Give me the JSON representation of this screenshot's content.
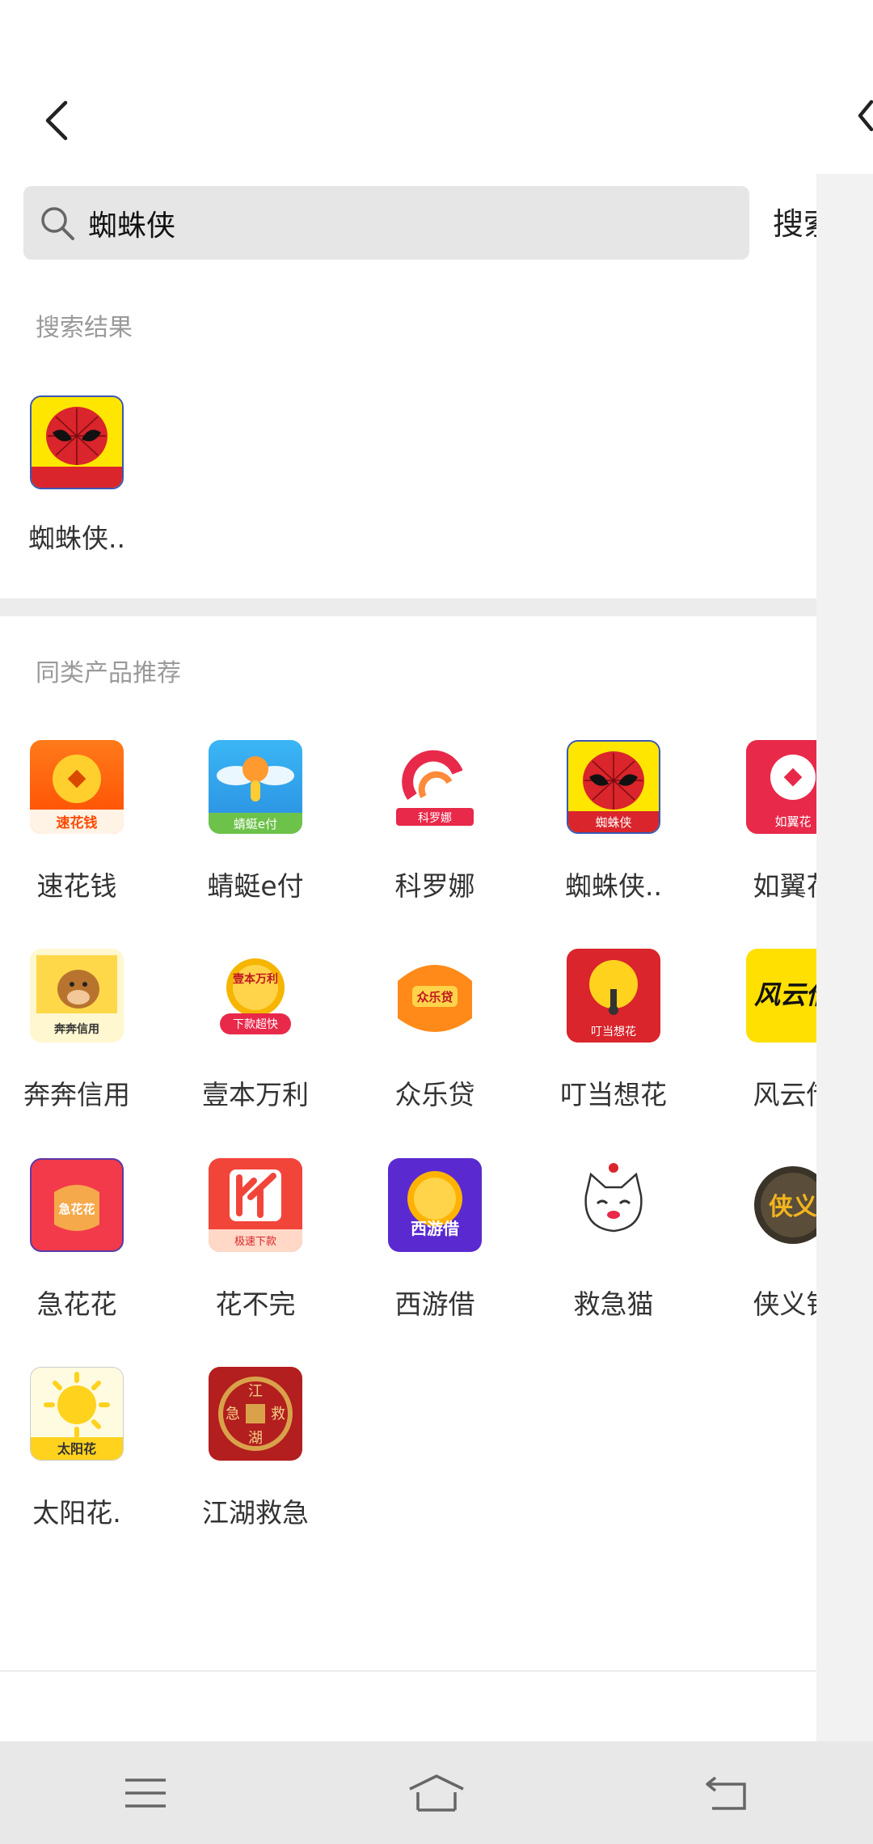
{
  "search": {
    "query": "蜘蛛侠",
    "button_label": "搜索"
  },
  "results": {
    "title": "搜索结果",
    "items": [
      {
        "label": "蜘蛛侠..",
        "icon": "spiderman-app-icon"
      }
    ]
  },
  "recommend": {
    "title": "同类产品推荐",
    "items": [
      {
        "label": "速花钱",
        "icon": "suhuaqian-app-icon"
      },
      {
        "label": "蜻蜓e付",
        "icon": "qingting-app-icon"
      },
      {
        "label": "科罗娜",
        "icon": "keluona-app-icon"
      },
      {
        "label": "蜘蛛侠..",
        "icon": "spiderman-app-icon"
      },
      {
        "label": "如翼花",
        "icon": "ruyihua-app-icon"
      },
      {
        "label": "奔奔信用",
        "icon": "benben-app-icon"
      },
      {
        "label": "壹本万利",
        "icon": "yibenwanli-app-icon"
      },
      {
        "label": "众乐贷",
        "icon": "zhongledai-app-icon"
      },
      {
        "label": "叮当想花",
        "icon": "dingdang-app-icon"
      },
      {
        "label": "风云借",
        "icon": "fengyun-app-icon"
      },
      {
        "label": "急花花",
        "icon": "jihuahua-app-icon"
      },
      {
        "label": "花不完",
        "icon": "huabuwan-app-icon"
      },
      {
        "label": "西游借",
        "icon": "xiyoujie-app-icon"
      },
      {
        "label": "救急猫",
        "icon": "jiujimao-app-icon"
      },
      {
        "label": "侠义钱",
        "icon": "xiayiqian-app-icon"
      },
      {
        "label": "太阳花.",
        "icon": "taiyanghua-app-icon"
      },
      {
        "label": "江湖救急",
        "icon": "jianghu-app-icon"
      }
    ]
  },
  "icon_texts": {
    "spiderman": "蜘蛛侠",
    "suhuaqian": "速花钱",
    "qingting": "蜻蜓e付",
    "keluona": "科罗娜",
    "ruyi": "如翼花",
    "benben": "奔奔信用",
    "yiben_top": "壹本万利",
    "yiben_bottom": "下款超快",
    "zhongle": "众乐贷",
    "dingdang": "叮当想花",
    "fengyun": "风云借",
    "jihuahua": "急花花",
    "huabuwan": "极速下款",
    "xiyou": "西游借",
    "xiayi": "侠义",
    "taiyang": "太阳花",
    "jianghu_top": "江",
    "jianghu_left": "急",
    "jianghu_right": "救",
    "jianghu_bottom": "湖"
  },
  "nav": {
    "menu_icon": "menu-icon",
    "home_icon": "home-icon",
    "back_icon": "back-icon"
  }
}
